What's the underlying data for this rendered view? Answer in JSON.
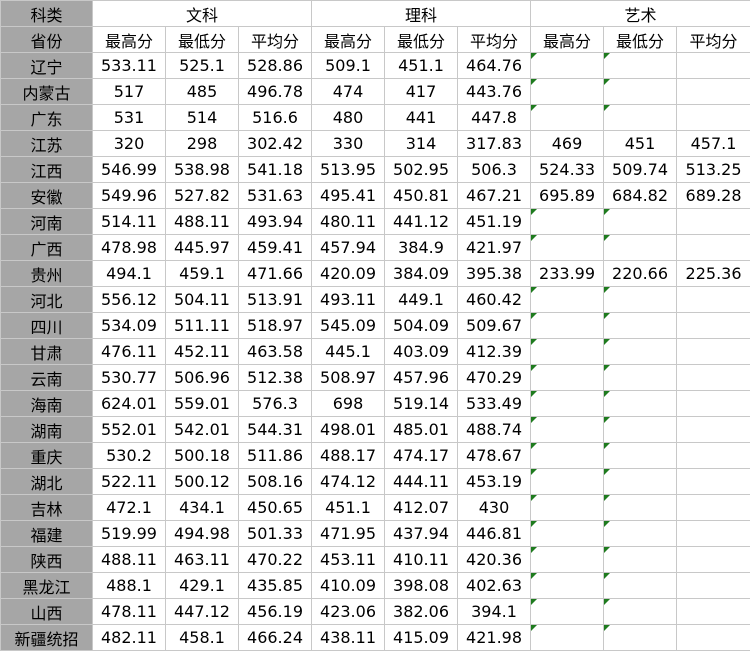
{
  "header": {
    "category_label": "科类",
    "province_label": "省份",
    "groups": [
      "文科",
      "理科",
      "艺术"
    ],
    "subheaders": [
      "最高分",
      "最低分",
      "平均分"
    ]
  },
  "rows": [
    {
      "province": "辽宁",
      "wen": [
        "533.11",
        "525.1",
        "528.86"
      ],
      "li": [
        "509.1",
        "451.1",
        "464.76"
      ],
      "yi": [
        "",
        "",
        ""
      ]
    },
    {
      "province": "内蒙古",
      "wen": [
        "517",
        "485",
        "496.78"
      ],
      "li": [
        "474",
        "417",
        "443.76"
      ],
      "yi": [
        "",
        "",
        ""
      ]
    },
    {
      "province": "广东",
      "wen": [
        "531",
        "514",
        "516.6"
      ],
      "li": [
        "480",
        "441",
        "447.8"
      ],
      "yi": [
        "",
        "",
        ""
      ]
    },
    {
      "province": "江苏",
      "wen": [
        "320",
        "298",
        "302.42"
      ],
      "li": [
        "330",
        "314",
        "317.83"
      ],
      "yi": [
        "469",
        "451",
        "457.1"
      ]
    },
    {
      "province": "江西",
      "wen": [
        "546.99",
        "538.98",
        "541.18"
      ],
      "li": [
        "513.95",
        "502.95",
        "506.3"
      ],
      "yi": [
        "524.33",
        "509.74",
        "513.25"
      ]
    },
    {
      "province": "安徽",
      "wen": [
        "549.96",
        "527.82",
        "531.63"
      ],
      "li": [
        "495.41",
        "450.81",
        "467.21"
      ],
      "yi": [
        "695.89",
        "684.82",
        "689.28"
      ]
    },
    {
      "province": "河南",
      "wen": [
        "514.11",
        "488.11",
        "493.94"
      ],
      "li": [
        "480.11",
        "441.12",
        "451.19"
      ],
      "yi": [
        "",
        "",
        ""
      ]
    },
    {
      "province": "广西",
      "wen": [
        "478.98",
        "445.97",
        "459.41"
      ],
      "li": [
        "457.94",
        "384.9",
        "421.97"
      ],
      "yi": [
        "",
        "",
        ""
      ]
    },
    {
      "province": "贵州",
      "wen": [
        "494.1",
        "459.1",
        "471.66"
      ],
      "li": [
        "420.09",
        "384.09",
        "395.38"
      ],
      "yi": [
        "233.99",
        "220.66",
        "225.36"
      ]
    },
    {
      "province": "河北",
      "wen": [
        "556.12",
        "504.11",
        "513.91"
      ],
      "li": [
        "493.11",
        "449.1",
        "460.42"
      ],
      "yi": [
        "",
        "",
        ""
      ]
    },
    {
      "province": "四川",
      "wen": [
        "534.09",
        "511.11",
        "518.97"
      ],
      "li": [
        "545.09",
        "504.09",
        "509.67"
      ],
      "yi": [
        "",
        "",
        ""
      ]
    },
    {
      "province": "甘肃",
      "wen": [
        "476.11",
        "452.11",
        "463.58"
      ],
      "li": [
        "445.1",
        "403.09",
        "412.39"
      ],
      "yi": [
        "",
        "",
        ""
      ]
    },
    {
      "province": "云南",
      "wen": [
        "530.77",
        "506.96",
        "512.38"
      ],
      "li": [
        "508.97",
        "457.96",
        "470.29"
      ],
      "yi": [
        "",
        "",
        ""
      ]
    },
    {
      "province": "海南",
      "wen": [
        "624.01",
        "559.01",
        "576.3"
      ],
      "li": [
        "698",
        "519.14",
        "533.49"
      ],
      "yi": [
        "",
        "",
        ""
      ]
    },
    {
      "province": "湖南",
      "wen": [
        "552.01",
        "542.01",
        "544.31"
      ],
      "li": [
        "498.01",
        "485.01",
        "488.74"
      ],
      "yi": [
        "",
        "",
        ""
      ]
    },
    {
      "province": "重庆",
      "wen": [
        "530.2",
        "500.18",
        "511.86"
      ],
      "li": [
        "488.17",
        "474.17",
        "478.67"
      ],
      "yi": [
        "",
        "",
        ""
      ]
    },
    {
      "province": "湖北",
      "wen": [
        "522.11",
        "500.12",
        "508.16"
      ],
      "li": [
        "474.12",
        "444.11",
        "453.19"
      ],
      "yi": [
        "",
        "",
        ""
      ]
    },
    {
      "province": "吉林",
      "wen": [
        "472.1",
        "434.1",
        "450.65"
      ],
      "li": [
        "451.1",
        "412.07",
        "430"
      ],
      "yi": [
        "",
        "",
        ""
      ]
    },
    {
      "province": "福建",
      "wen": [
        "519.99",
        "494.98",
        "501.33"
      ],
      "li": [
        "471.95",
        "437.94",
        "446.81"
      ],
      "yi": [
        "",
        "",
        ""
      ]
    },
    {
      "province": "陕西",
      "wen": [
        "488.11",
        "463.11",
        "470.22"
      ],
      "li": [
        "453.11",
        "410.11",
        "420.36"
      ],
      "yi": [
        "",
        "",
        ""
      ]
    },
    {
      "province": "黑龙江",
      "wen": [
        "488.1",
        "429.1",
        "435.85"
      ],
      "li": [
        "410.09",
        "398.08",
        "402.63"
      ],
      "yi": [
        "",
        "",
        ""
      ]
    },
    {
      "province": "山西",
      "wen": [
        "478.11",
        "447.12",
        "456.19"
      ],
      "li": [
        "423.06",
        "382.06",
        "394.1"
      ],
      "yi": [
        "",
        "",
        ""
      ]
    },
    {
      "province": "新疆统招",
      "wen": [
        "482.11",
        "458.1",
        "466.24"
      ],
      "li": [
        "438.11",
        "415.09",
        "421.98"
      ],
      "yi": [
        "",
        "",
        ""
      ]
    }
  ],
  "colors": {
    "label_fill": "#a6a6a6",
    "grid_line": "#c8c8c8",
    "comment_marker": "#1e7b1e"
  }
}
